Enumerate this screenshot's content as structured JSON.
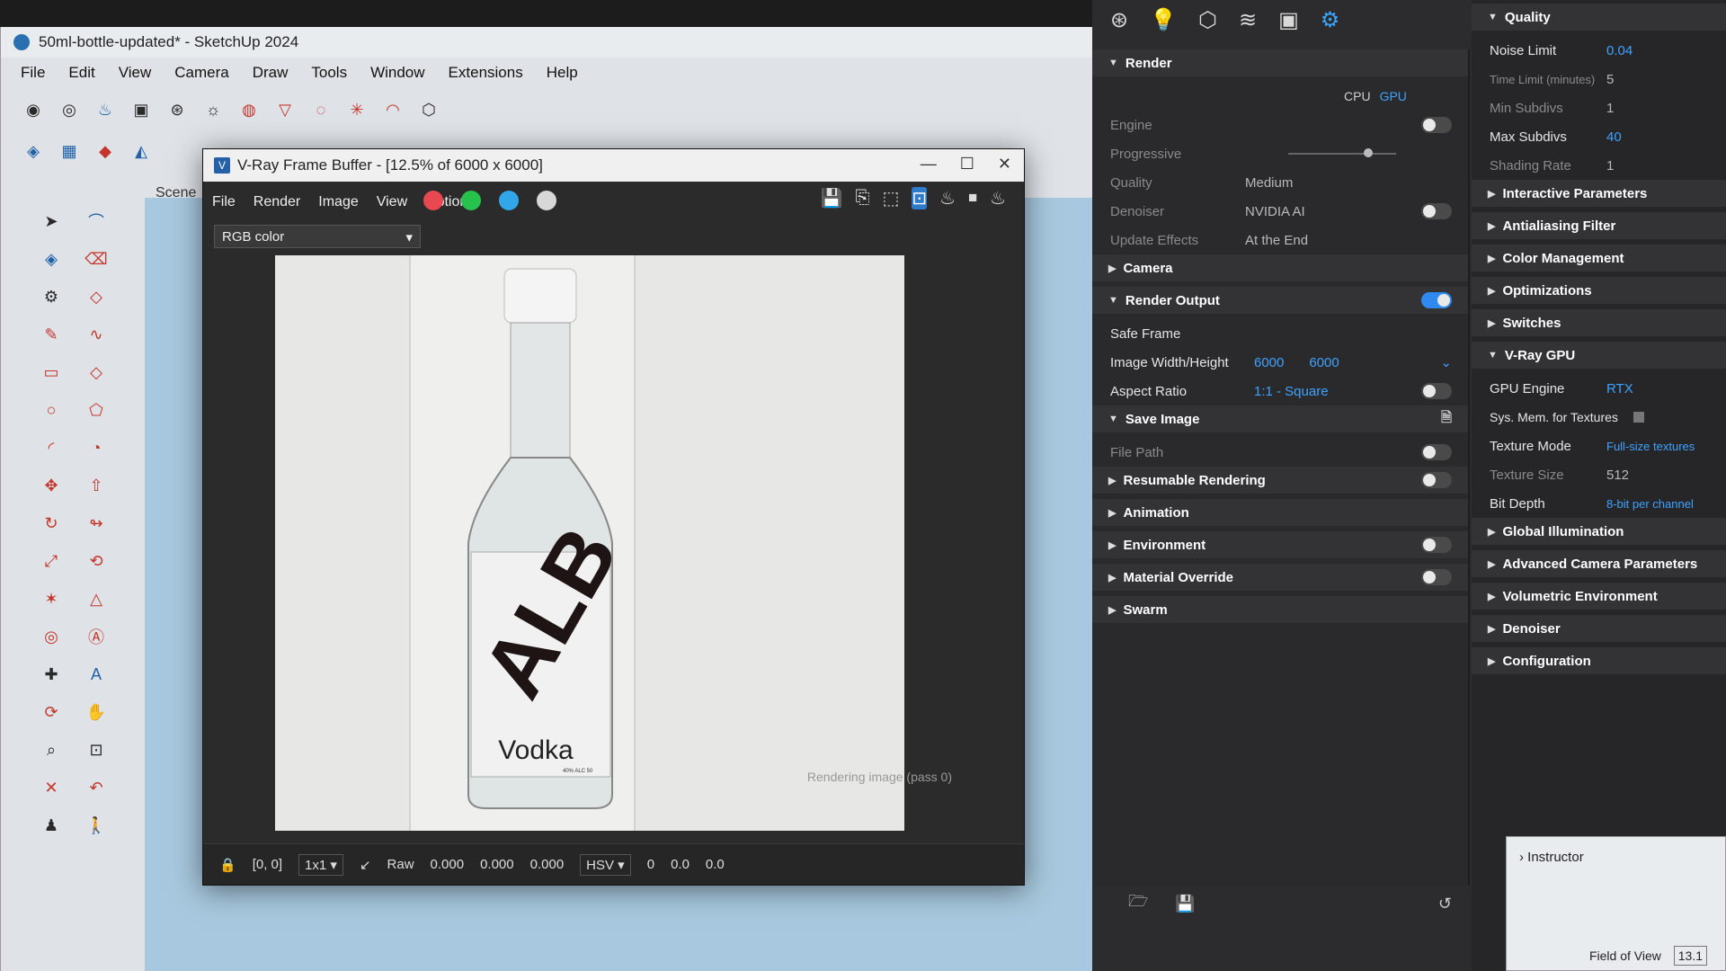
{
  "sketchup": {
    "title": "50ml-bottle-updated* - SketchUp 2024",
    "menu": [
      "File",
      "Edit",
      "View",
      "Camera",
      "Draw",
      "Tools",
      "Window",
      "Extensions",
      "Help"
    ],
    "scene_tab": "Scene"
  },
  "vfb": {
    "title": "V-Ray Frame Buffer - [12.5% of 6000 x 6000]",
    "menu": [
      "File",
      "Render",
      "Image",
      "View",
      "Options"
    ],
    "channel": "RGB color",
    "dot_colors": [
      "#e8484f",
      "#27c24c",
      "#31a6e8",
      "#d8d8d8"
    ],
    "status": {
      "coords": "[0, 0]",
      "zoom": "1x1",
      "raw_label": "Raw",
      "r": "0.000",
      "g": "0.000",
      "b": "0.000",
      "color_mode": "HSV",
      "h": "0",
      "s": "0.0",
      "v": "0.0"
    },
    "render_msg": "Rendering image (pass 0)",
    "bottle_label": {
      "brand": "ALB",
      "product": "Vodka",
      "fine": "40% ALC 50"
    }
  },
  "vray": {
    "render": {
      "title": "Render",
      "cpu": "CPU",
      "gpu": "GPU",
      "engine_label": "Engine",
      "progressive_label": "Progressive",
      "quality_label": "Quality",
      "quality_value": "Medium",
      "denoiser_label": "Denoiser",
      "denoiser_value": "NVIDIA AI",
      "update_effects_label": "Update Effects",
      "update_effects_value": "At the End"
    },
    "camera_title": "Camera",
    "render_output": {
      "title": "Render Output",
      "safe_frame": "Safe Frame",
      "wh_label": "Image Width/Height",
      "width": "6000",
      "height": "6000",
      "aspect_label": "Aspect Ratio",
      "aspect_value": "1:1 - Square"
    },
    "save_image": {
      "title": "Save Image",
      "file_path": "File Path"
    },
    "collapsed": [
      "Resumable Rendering",
      "Animation",
      "Environment",
      "Material Override",
      "Swarm"
    ],
    "quality": {
      "title": "Quality",
      "noise_limit_label": "Noise Limit",
      "noise_limit_value": "0.04",
      "time_limit_label": "Time Limit (minutes)",
      "time_limit_value": "5",
      "min_subdivs_label": "Min Subdivs",
      "min_subdivs_value": "1",
      "max_subdivs_label": "Max Subdivs",
      "max_subdivs_value": "40",
      "shading_rate_label": "Shading Rate",
      "shading_rate_value": "1"
    },
    "right_sections": [
      "Interactive Parameters",
      "Antialiasing Filter",
      "Color Management",
      "Optimizations",
      "Switches"
    ],
    "gpu": {
      "title": "V-Ray GPU",
      "engine_label": "GPU Engine",
      "engine_value": "RTX",
      "sysmem_label": "Sys. Mem. for Textures",
      "texture_mode_label": "Texture Mode",
      "texture_mode_value": "Full-size textures",
      "texture_size_label": "Texture Size",
      "texture_size_value": "512",
      "bit_depth_label": "Bit Depth",
      "bit_depth_value": "8-bit per channel"
    },
    "right_bottom_sections": [
      "Global Illumination",
      "Advanced Camera Parameters",
      "Volumetric Environment",
      "Denoiser",
      "Configuration"
    ]
  },
  "instructor": {
    "title": "Instructor",
    "fov": "Field of View",
    "fov_value": "13.1"
  }
}
